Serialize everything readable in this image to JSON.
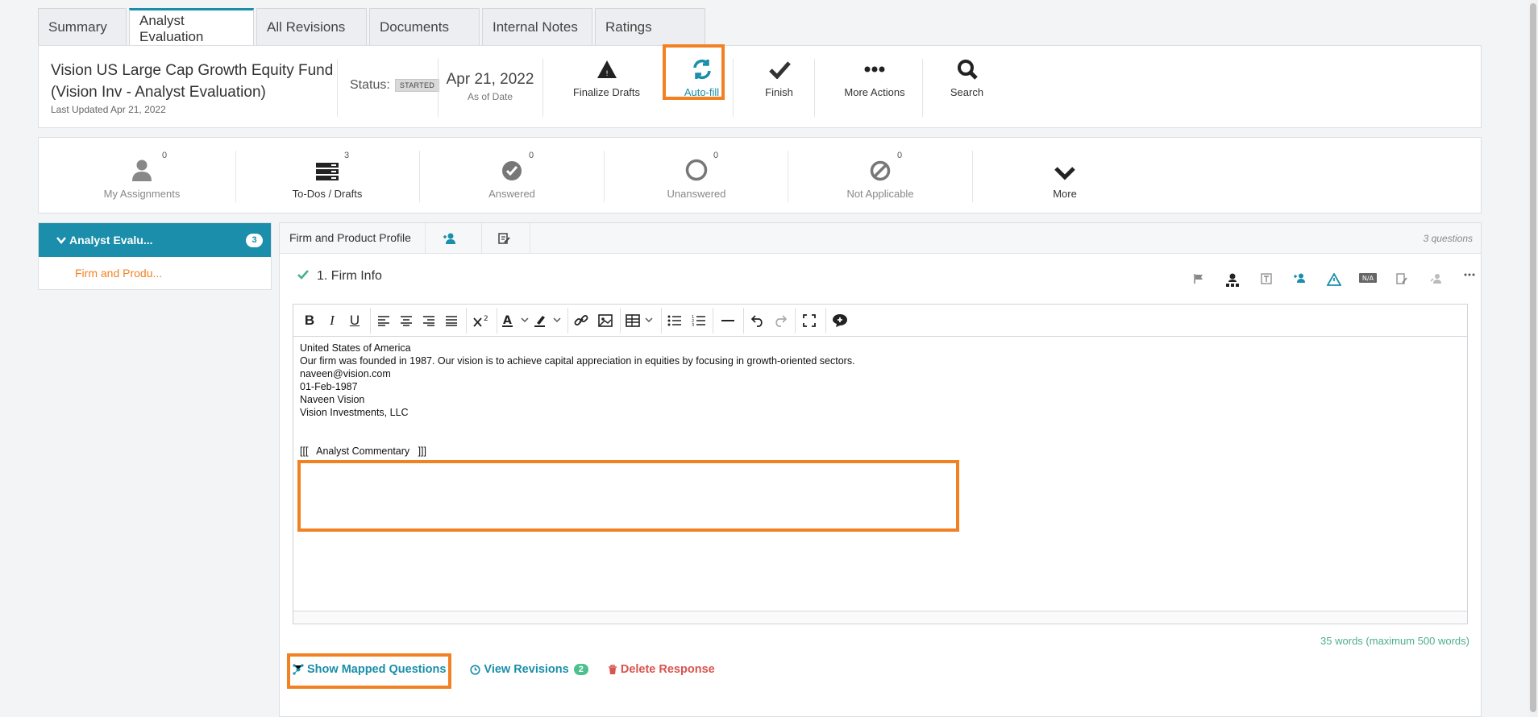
{
  "tabs": [
    "Summary",
    "Analyst Evaluation",
    "All Revisions",
    "Documents",
    "Internal Notes",
    "Ratings"
  ],
  "header": {
    "fund_title": "Vision US Large Cap Growth Equity Fund (Vision Inv - Analyst Evaluation)",
    "last_updated": "Last Updated Apr 21, 2022",
    "status_label": "Status:",
    "status_badge": "STARTED",
    "as_of_date": "Apr 21, 2022",
    "as_of_label": "As of Date",
    "tools": {
      "finalize": "Finalize Drafts",
      "autofill": "Auto-fill",
      "finish": "Finish",
      "more_actions": "More Actions",
      "search": "Search"
    }
  },
  "stats": [
    {
      "label": "My Assignments",
      "count": "0"
    },
    {
      "label": "To-Dos / Drafts",
      "count": "3"
    },
    {
      "label": "Answered",
      "count": "0"
    },
    {
      "label": "Unanswered",
      "count": "0"
    },
    {
      "label": "Not Applicable",
      "count": "0"
    },
    {
      "label": "More",
      "count": ""
    }
  ],
  "sidebar": {
    "section": "Analyst Evalu...",
    "section_count": "3",
    "items": [
      "Firm and Produ..."
    ]
  },
  "main": {
    "bar_title": "Firm and Product Profile",
    "questions_count": "3 questions",
    "question_title": "1. Firm Info",
    "editor_lines": [
      "United States of America",
      "Our firm was founded in 1987. Our vision is to achieve capital appreciation in equities by focusing in growth-oriented sectors.",
      "naveen@vision.com",
      "01-Feb-1987",
      "Naveen Vision",
      "Vision Investments, LLC",
      "",
      "",
      "[[[   Analyst Commentary   ]]]"
    ],
    "word_count": "35 words (maximum 500 words)",
    "actions": {
      "show_mapped": "Show Mapped Questions",
      "view_revisions": "View Revisions",
      "revisions_count": "2",
      "delete_response": "Delete Response"
    }
  },
  "colors": {
    "accent": "#1a8eaa",
    "highlight": "#f28123",
    "success": "#4cae8a",
    "danger": "#d9534f"
  }
}
